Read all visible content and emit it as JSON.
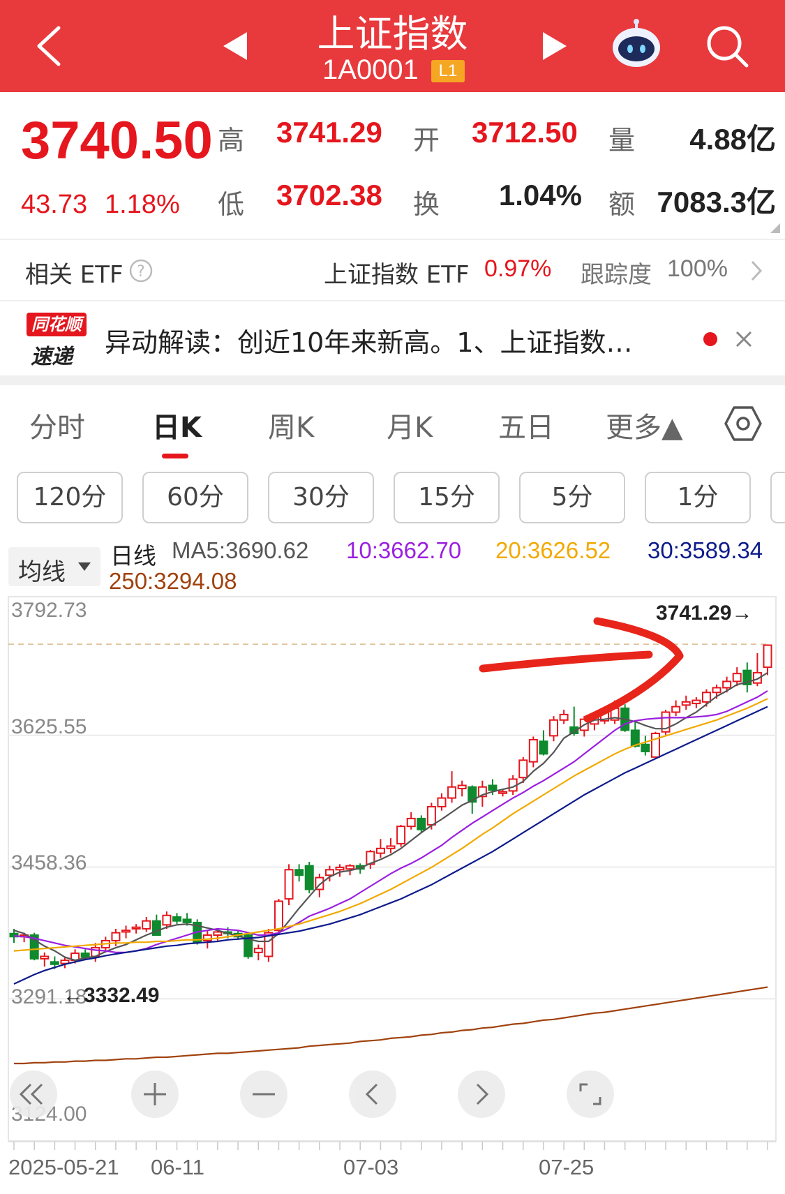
{
  "header": {
    "title": "上证指数",
    "code": "1A0001",
    "level_badge": "L1",
    "icons": [
      "back-chevron-icon",
      "prev-triangle-icon",
      "next-triangle-icon",
      "robot-assistant-icon",
      "search-icon"
    ]
  },
  "quote": {
    "price": "3740.50",
    "change": "43.73",
    "change_pct": "1.18%",
    "high_label": "高",
    "high": "3741.29",
    "open_label": "开",
    "open": "3712.50",
    "volume_label": "量",
    "volume": "4.88亿",
    "low_label": "低",
    "low": "3702.38",
    "turnover_label": "换",
    "turnover": "1.04%",
    "amount_label": "额",
    "amount": "7083.3亿"
  },
  "etf": {
    "label": "相关 ETF",
    "name": "上证指数 ETF",
    "pct": "0.97%",
    "track_label": "跟踪度",
    "track": "100%"
  },
  "news": {
    "badge_top": "同花顺",
    "badge_bottom": "速递",
    "text": "异动解读：创近10年来新高。1、上证指数…"
  },
  "tabs": [
    "分时",
    "日K",
    "周K",
    "月K",
    "五日",
    "更多▲"
  ],
  "active_tab": "日K",
  "period_tabs": [
    "120分",
    "60分",
    "30分",
    "15分",
    "5分",
    "1分"
  ],
  "indicator": {
    "dropdown": "均线",
    "line_label": "日线",
    "ma5": "MA5:3690.62",
    "ma10": "10:3662.70",
    "ma20": "20:3626.52",
    "ma30": "30:3589.34",
    "ma250": "250:3294.08"
  },
  "colors": {
    "header": "#e8393c",
    "up": "#e5161d",
    "down": "#0f8a2e",
    "ma5": "#555555",
    "ma10": "#9b1fe0",
    "ma20": "#f2a900",
    "ma30": "#0d1b8c",
    "ma250": "#a0420e"
  },
  "chart_data": {
    "type": "candlestick",
    "y_ticks": [
      "3792.73",
      "3625.55",
      "3458.36",
      "3291.18",
      "3124.00"
    ],
    "x_ticks": [
      "2025-05-21",
      "06-11",
      "07-03",
      "07-25"
    ],
    "ylim": [
      3124.0,
      3792.73
    ],
    "max_label": "3741.29→",
    "min_label": "←3332.49",
    "candles": [
      [
        3374,
        3380,
        3362,
        3370
      ],
      [
        3370,
        3375,
        3363,
        3372
      ],
      [
        3372,
        3375,
        3340,
        3342
      ],
      [
        3342,
        3350,
        3332,
        3345
      ],
      [
        3338,
        3345,
        3329,
        3335
      ],
      [
        3336,
        3344,
        3330,
        3340
      ],
      [
        3340,
        3354,
        3336,
        3349
      ],
      [
        3349,
        3354,
        3340,
        3344
      ],
      [
        3345,
        3362,
        3338,
        3356
      ],
      [
        3356,
        3370,
        3350,
        3365
      ],
      [
        3365,
        3380,
        3358,
        3375
      ],
      [
        3376,
        3384,
        3368,
        3378
      ],
      [
        3380,
        3386,
        3374,
        3382
      ],
      [
        3380,
        3395,
        3376,
        3390
      ],
      [
        3390,
        3398,
        3378,
        3372
      ],
      [
        3385,
        3402,
        3380,
        3397
      ],
      [
        3395,
        3400,
        3386,
        3390
      ],
      [
        3392,
        3400,
        3384,
        3388
      ],
      [
        3388,
        3392,
        3360,
        3363
      ],
      [
        3365,
        3378,
        3355,
        3372
      ],
      [
        3372,
        3380,
        3365,
        3376
      ],
      [
        3376,
        3382,
        3368,
        3374
      ],
      [
        3374,
        3378,
        3366,
        3370
      ],
      [
        3372,
        3375,
        3342,
        3345
      ],
      [
        3350,
        3360,
        3340,
        3355
      ],
      [
        3345,
        3380,
        3338,
        3375
      ],
      [
        3378,
        3418,
        3375,
        3415
      ],
      [
        3418,
        3462,
        3410,
        3455
      ],
      [
        3455,
        3462,
        3440,
        3448
      ],
      [
        3460,
        3465,
        3425,
        3430
      ],
      [
        3430,
        3450,
        3420,
        3445
      ],
      [
        3448,
        3460,
        3440,
        3455
      ],
      [
        3455,
        3462,
        3446,
        3458
      ],
      [
        3456,
        3462,
        3448,
        3460
      ],
      [
        3460,
        3463,
        3450,
        3456
      ],
      [
        3462,
        3480,
        3456,
        3478
      ],
      [
        3476,
        3494,
        3470,
        3482
      ],
      [
        3482,
        3495,
        3476,
        3485
      ],
      [
        3488,
        3512,
        3484,
        3510
      ],
      [
        3510,
        3528,
        3506,
        3520
      ],
      [
        3520,
        3524,
        3502,
        3506
      ],
      [
        3512,
        3540,
        3506,
        3535
      ],
      [
        3535,
        3552,
        3530,
        3546
      ],
      [
        3546,
        3580,
        3540,
        3560
      ],
      [
        3558,
        3568,
        3548,
        3562
      ],
      [
        3560,
        3562,
        3526,
        3541
      ],
      [
        3548,
        3568,
        3535,
        3560
      ],
      [
        3562,
        3570,
        3550,
        3556
      ],
      [
        3552,
        3558,
        3548,
        3554
      ],
      [
        3555,
        3575,
        3550,
        3570
      ],
      [
        3572,
        3598,
        3565,
        3594
      ],
      [
        3592,
        3624,
        3585,
        3620
      ],
      [
        3618,
        3632,
        3600,
        3602
      ],
      [
        3625,
        3650,
        3618,
        3645
      ],
      [
        3645,
        3658,
        3640,
        3652
      ],
      [
        3636,
        3662,
        3625,
        3628
      ],
      [
        3632,
        3650,
        3624,
        3646
      ],
      [
        3640,
        3655,
        3632,
        3650
      ],
      [
        3644,
        3660,
        3640,
        3656
      ],
      [
        3645,
        3670,
        3640,
        3660
      ],
      [
        3660,
        3665,
        3630,
        3632
      ],
      [
        3632,
        3645,
        3610,
        3612
      ],
      [
        3614,
        3625,
        3600,
        3605
      ],
      [
        3598,
        3630,
        3596,
        3628
      ],
      [
        3630,
        3658,
        3626,
        3655
      ],
      [
        3655,
        3670,
        3650,
        3662
      ],
      [
        3664,
        3676,
        3658,
        3668
      ],
      [
        3666,
        3674,
        3660,
        3670
      ],
      [
        3668,
        3684,
        3662,
        3680
      ],
      [
        3680,
        3690,
        3672,
        3686
      ],
      [
        3686,
        3700,
        3680,
        3694
      ],
      [
        3694,
        3712,
        3688,
        3704
      ],
      [
        3708,
        3718,
        3680,
        3690
      ],
      [
        3692,
        3730,
        3688,
        3705
      ],
      [
        3712,
        3741,
        3702,
        3740
      ]
    ],
    "series": [
      {
        "name": "MA5",
        "values": [
          3378,
          3374,
          3366,
          3358,
          3352,
          3344,
          3340,
          3343,
          3345,
          3351,
          3356,
          3360,
          3366,
          3372,
          3377,
          3382,
          3385,
          3386,
          3384,
          3381,
          3378,
          3374,
          3371,
          3367,
          3364,
          3364,
          3374,
          3390,
          3406,
          3421,
          3436,
          3446,
          3452,
          3454,
          3457,
          3463,
          3468,
          3474,
          3482,
          3492,
          3502,
          3511,
          3519,
          3528,
          3537,
          3543,
          3550,
          3554,
          3557,
          3560,
          3567,
          3580,
          3590,
          3604,
          3622,
          3630,
          3639,
          3645,
          3646,
          3648,
          3646,
          3643,
          3638,
          3634,
          3634,
          3640,
          3648,
          3655,
          3665,
          3675,
          3682,
          3690,
          3693,
          3697,
          3705
        ]
      },
      {
        "name": "MA10",
        "values": [
          3371,
          3370,
          3368,
          3365,
          3362,
          3359,
          3357,
          3355,
          3353,
          3352,
          3350,
          3350,
          3352,
          3355,
          3360,
          3364,
          3368,
          3372,
          3376,
          3378,
          3380,
          3379,
          3378,
          3375,
          3372,
          3372,
          3375,
          3381,
          3388,
          3396,
          3401,
          3406,
          3412,
          3418,
          3426,
          3434,
          3442,
          3450,
          3457,
          3463,
          3470,
          3478,
          3486,
          3496,
          3505,
          3514,
          3522,
          3530,
          3538,
          3546,
          3553,
          3561,
          3568,
          3576,
          3584,
          3592,
          3602,
          3612,
          3622,
          3632,
          3640,
          3644,
          3646,
          3647,
          3648,
          3648,
          3648,
          3649,
          3650,
          3652,
          3656,
          3662,
          3668,
          3674,
          3682
        ]
      },
      {
        "name": "MA20",
        "values": [
          3352,
          3353,
          3354,
          3355,
          3356,
          3357,
          3358,
          3359,
          3360,
          3361,
          3362,
          3362,
          3363,
          3363,
          3364,
          3364,
          3365,
          3366,
          3366,
          3367,
          3368,
          3370,
          3372,
          3374,
          3376,
          3378,
          3380,
          3383,
          3386,
          3390,
          3394,
          3398,
          3402,
          3407,
          3412,
          3418,
          3424,
          3430,
          3437,
          3444,
          3451,
          3458,
          3466,
          3474,
          3482,
          3491,
          3500,
          3508,
          3517,
          3526,
          3534,
          3542,
          3550,
          3558,
          3566,
          3574,
          3581,
          3588,
          3595,
          3602,
          3608,
          3613,
          3617,
          3621,
          3625,
          3629,
          3633,
          3637,
          3641,
          3645,
          3650,
          3655,
          3660,
          3666,
          3672
        ]
      },
      {
        "name": "MA30",
        "values": [
          3310,
          3316,
          3322,
          3327,
          3331,
          3335,
          3338,
          3341,
          3343,
          3346,
          3348,
          3350,
          3352,
          3354,
          3356,
          3358,
          3359,
          3361,
          3362,
          3363,
          3364,
          3366,
          3367,
          3368,
          3369,
          3371,
          3373,
          3375,
          3377,
          3380,
          3383,
          3386,
          3390,
          3394,
          3398,
          3403,
          3408,
          3413,
          3418,
          3424,
          3430,
          3436,
          3443,
          3450,
          3457,
          3464,
          3471,
          3478,
          3486,
          3494,
          3502,
          3510,
          3518,
          3526,
          3534,
          3542,
          3550,
          3557,
          3564,
          3571,
          3578,
          3584,
          3590,
          3596,
          3602,
          3608,
          3614,
          3620,
          3626,
          3632,
          3638,
          3644,
          3650,
          3656,
          3662
        ]
      },
      {
        "name": "MA250",
        "values": [
          3209,
          3209,
          3210,
          3210,
          3211,
          3211,
          3212,
          3212,
          3213,
          3213,
          3214,
          3215,
          3215,
          3216,
          3217,
          3217,
          3218,
          3219,
          3220,
          3221,
          3222,
          3222,
          3223,
          3224,
          3225,
          3226,
          3227,
          3228,
          3229,
          3231,
          3232,
          3233,
          3234,
          3235,
          3237,
          3238,
          3239,
          3241,
          3242,
          3243,
          3245,
          3246,
          3248,
          3249,
          3251,
          3252,
          3254,
          3255,
          3257,
          3259,
          3260,
          3262,
          3264,
          3265,
          3267,
          3269,
          3271,
          3273,
          3274,
          3276,
          3278,
          3280,
          3282,
          3284,
          3286,
          3288,
          3290,
          3292,
          3294,
          3296,
          3298,
          3300,
          3302,
          3304,
          3306
        ]
      }
    ]
  }
}
